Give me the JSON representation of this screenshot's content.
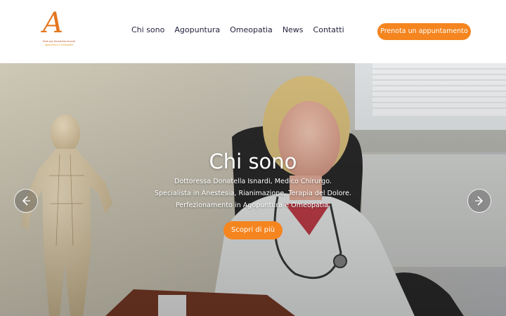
{
  "brand": {
    "logo_letter": "A",
    "logo_line1": "Dott.ssa Donatella Isnardi",
    "logo_line2": "Agopuntura e Omeopatia"
  },
  "nav": {
    "items": [
      {
        "label": "Chi sono"
      },
      {
        "label": "Agopuntura"
      },
      {
        "label": "Omeopatia"
      },
      {
        "label": "News"
      },
      {
        "label": "Contatti"
      }
    ]
  },
  "header": {
    "cta_label": "Prenota un appuntamento"
  },
  "hero": {
    "title": "Chi sono",
    "line1": "Dottoressa Donatella Isnardi, Medico Chirurgo.",
    "line2": "Specialista in Anestesia, Rianimazione, Terapia del Dolore.",
    "line3": "Perfezionamento in Agopuntura e Omeopatia.",
    "button_label": "Scopri di più",
    "prev_icon": "chevron-left-icon",
    "next_icon": "chevron-right-icon"
  },
  "colors": {
    "accent": "#f5851f",
    "nav_text": "#23233f",
    "hero_text": "#ffffff"
  }
}
